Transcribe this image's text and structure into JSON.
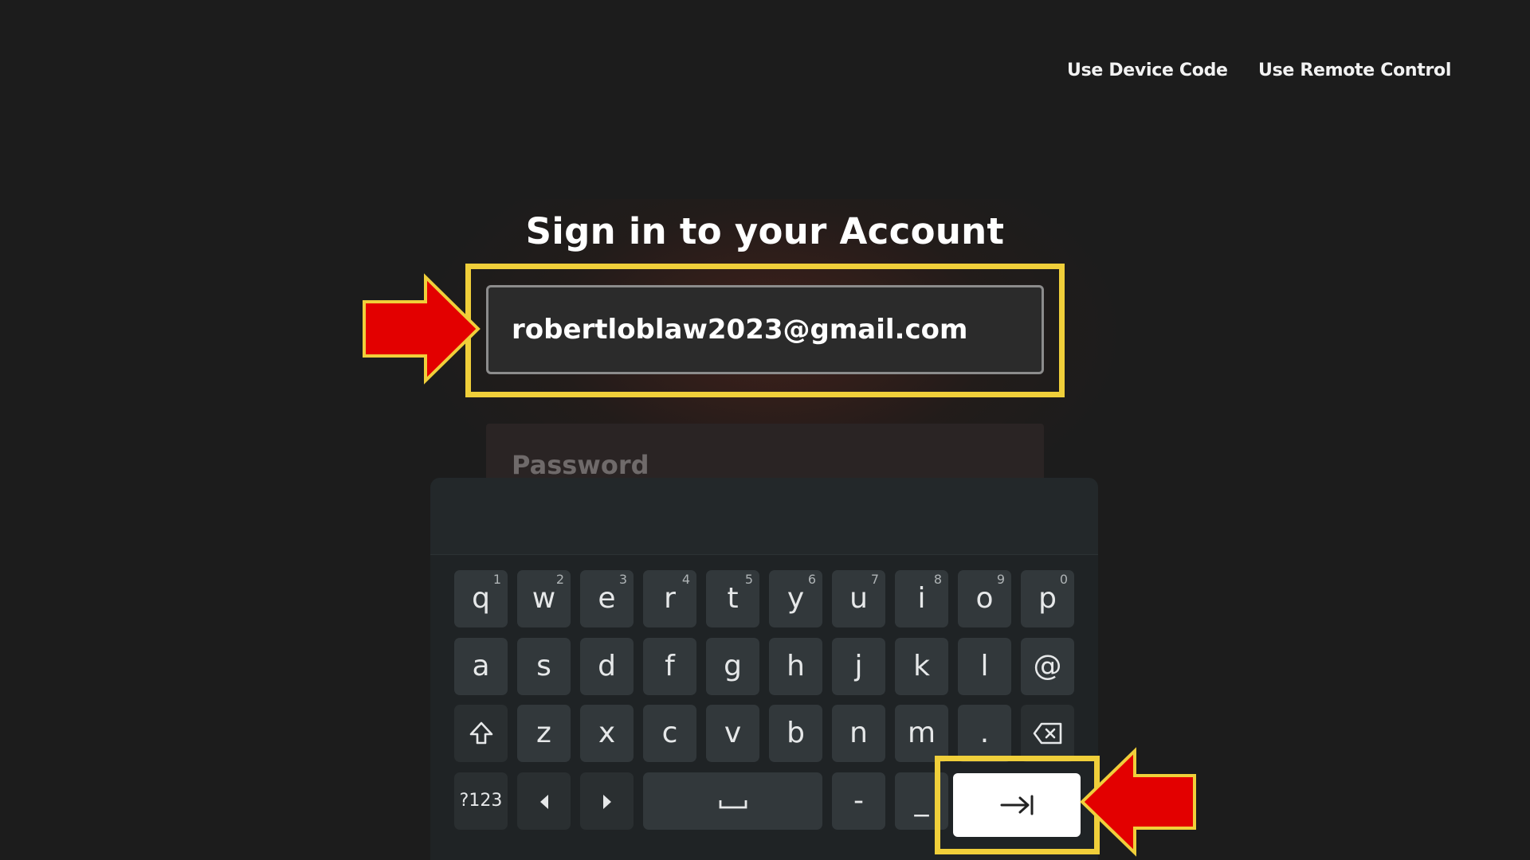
{
  "header": {
    "device_code_link": "Use Device Code",
    "remote_control_link": "Use Remote Control"
  },
  "title": "Sign in to your Account",
  "form": {
    "email_value": "robertloblaw2023@gmail.com",
    "password_placeholder": "Password"
  },
  "keyboard": {
    "row1": [
      {
        "key": "q",
        "alt": "1"
      },
      {
        "key": "w",
        "alt": "2"
      },
      {
        "key": "e",
        "alt": "3"
      },
      {
        "key": "r",
        "alt": "4"
      },
      {
        "key": "t",
        "alt": "5"
      },
      {
        "key": "y",
        "alt": "6"
      },
      {
        "key": "u",
        "alt": "7"
      },
      {
        "key": "i",
        "alt": "8"
      },
      {
        "key": "o",
        "alt": "9"
      },
      {
        "key": "p",
        "alt": "0"
      }
    ],
    "row2": [
      "a",
      "s",
      "d",
      "f",
      "g",
      "h",
      "j",
      "k",
      "l",
      "@"
    ],
    "row3": [
      "z",
      "x",
      "c",
      "v",
      "b",
      "n",
      "m",
      "."
    ],
    "symbols_label": "?123",
    "dash": "-",
    "underscore": "_"
  },
  "colors": {
    "highlight": "#f0cf3a",
    "arrow": "#e30000",
    "background": "#1c1c1c",
    "key": "#32383b"
  }
}
